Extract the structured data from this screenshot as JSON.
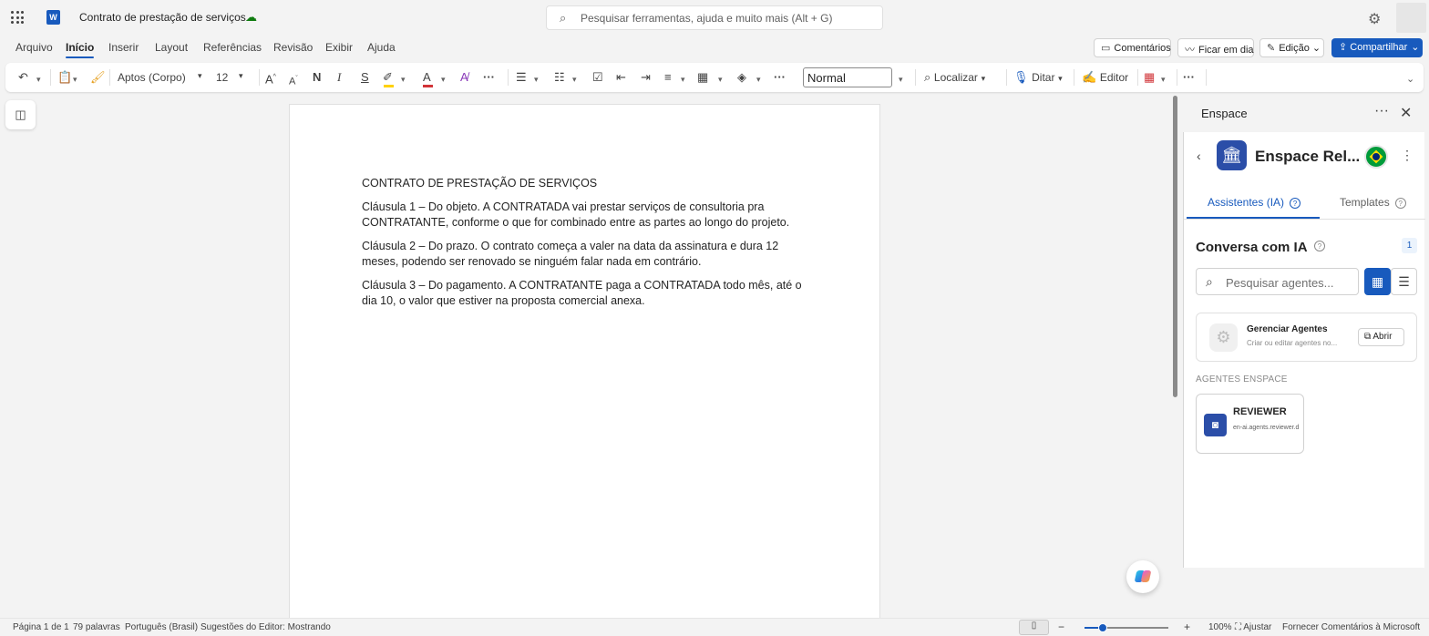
{
  "titlebar": {
    "app_icon": "word-icon",
    "doc_title": "Contrato de prestação de serviços",
    "search_placeholder": "Pesquisar ferramentas, ajuda e muito mais (Alt + G)"
  },
  "menu": {
    "items": [
      "Arquivo",
      "Início",
      "Inserir",
      "Layout",
      "Referências",
      "Revisão",
      "Exibir",
      "Ajuda"
    ],
    "active": "Início",
    "comments": "Comentários",
    "catchup": "Ficar em dia",
    "editing": "Edição",
    "share": "Compartilhar"
  },
  "ribbon": {
    "font_name": "Aptos (Corpo)",
    "font_size": "12",
    "style": "Normal",
    "find": "Localizar",
    "dictate": "Ditar",
    "editor": "Editor",
    "font_color": "#d13438",
    "highlight_color": "#ffd100"
  },
  "document": {
    "paragraphs": [
      "CONTRATO DE PRESTAÇÃO DE SERVIÇOS",
      "Cláusula 1 – Do objeto. A CONTRATADA vai prestar serviços de consultoria pra CONTRATANTE, conforme o que for combinado entre as partes ao longo do projeto.",
      "Cláusula 2 – Do prazo. O contrato começa a valer na data da assinatura e dura 12 meses, podendo ser renovado se ninguém falar nada em contrário.",
      "Cláusula 3 – Do pagamento. A CONTRATANTE paga a CONTRATADA todo mês, até o dia 10, o valor que estiver na proposta comercial anexa."
    ]
  },
  "pane": {
    "title": "Enspace",
    "app_name": "Enspace Rel...",
    "tabs": [
      "Assistentes (IA)",
      "Templates"
    ],
    "active_tab": "Assistentes (IA)",
    "conversation_title": "Conversa com IA",
    "count": "1",
    "search_placeholder": "Pesquisar agentes...",
    "manage": {
      "title": "Gerenciar Agentes",
      "subtitle": "Criar ou editar agentes no...",
      "open": "Abrir"
    },
    "section_label": "AGENTES ENSPACE",
    "agent": {
      "name": "REVIEWER",
      "id": "en-ai.agents.reviewer.d"
    }
  },
  "status": {
    "page": "Página 1 de 1",
    "words": "79 palavras",
    "language": "Português (Brasil)",
    "suggestions": "Sugestões do Editor: Mostrando",
    "zoom": "100%",
    "zoom_level": 0.22,
    "fit": "Ajustar",
    "feedback": "Fornecer Comentários à Microsoft"
  },
  "colors": {
    "accent": "#185abd",
    "brand_dark": "#2b4ea8"
  }
}
